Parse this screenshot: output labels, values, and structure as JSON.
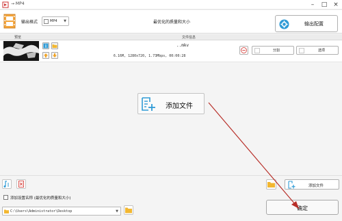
{
  "titlebar": {
    "title": "→ MP4",
    "minimize_glyph": "–",
    "maximize_glyph": "□",
    "close_glyph": "×"
  },
  "header": {
    "format_label": "输出格式",
    "format_value": "MP4",
    "quality_text": "最优化的质量和大小",
    "output_config_label": "输出配置"
  },
  "list": {
    "col_preview": "预览",
    "col_info": "文件信息",
    "file": {
      "name": "..mkv",
      "meta": "6.16M, 1280x720, 1.73Mbps, 00:00:28",
      "split_label": "分割",
      "options_label": "选项"
    }
  },
  "center_add_label": "添加文件",
  "bottom": {
    "add_file_label": "添加文件",
    "suffix_label": "添加设置名称 (最优化的质量和大小)",
    "output_path": "C:\\Users\\Administrator\\Desktop",
    "confirm_label": "确定"
  },
  "colors": {
    "accent_blue": "#2f9bd6",
    "folder_yellow": "#f2b731",
    "arrow_red": "#b8302a"
  },
  "icons": [
    "app-icon",
    "film-icon",
    "gear-icon",
    "info-icon",
    "folder-icon",
    "arrow-up-icon",
    "arrow-down-icon",
    "remove-icon",
    "add-file-icon",
    "music-note-icon",
    "clear-list-icon",
    "path-folder-icon"
  ]
}
